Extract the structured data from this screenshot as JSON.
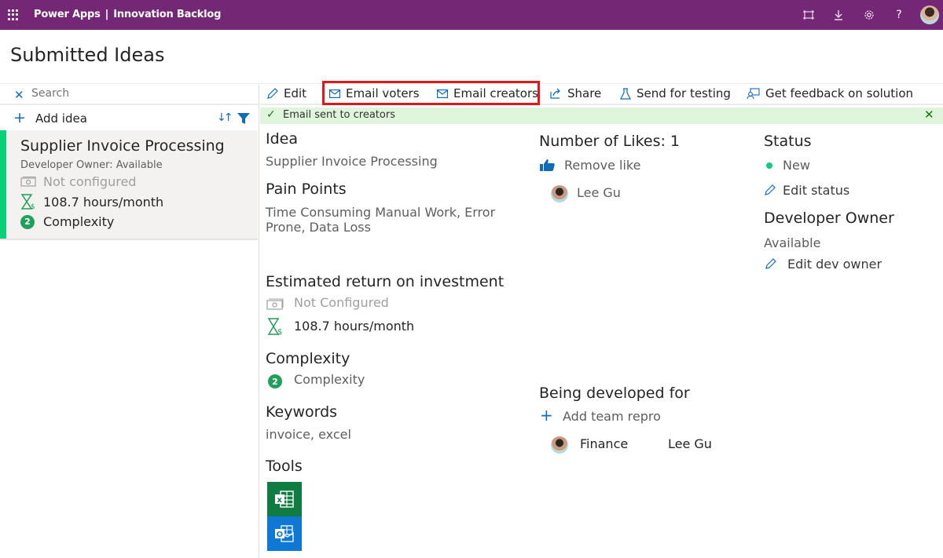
{
  "topbar": {
    "app_name": "Power Apps",
    "separator": "|",
    "app_title": "Innovation Backlog",
    "icons": [
      "fit-screen-icon",
      "download-icon",
      "settings-icon",
      "help-icon",
      "user-avatar"
    ],
    "help_glyph": "?",
    "background": "#742774"
  },
  "page": {
    "title": "Submitted Ideas"
  },
  "left_panel": {
    "search": {
      "placeholder": "Search",
      "value": ""
    },
    "add_idea_label": "Add idea",
    "ideas": [
      {
        "title": "Supplier Invoice Processing",
        "developer_owner": "Developer Owner: Available",
        "roi": "Not configured",
        "hours": "108.7 hours/month",
        "complexity_value": "2",
        "complexity_label": "Complexity",
        "accent_color": "#0bd07a"
      }
    ]
  },
  "toolbar": {
    "edit": "Edit",
    "email_voters": "Email voters",
    "email_creators": "Email creators",
    "share": "Share",
    "send_for_testing": "Send for testing",
    "get_feedback": "Get feedback on solution"
  },
  "banner": {
    "check": "✓",
    "message": "Email sent to creators",
    "close": "✕"
  },
  "detail": {
    "idea_heading": "Idea",
    "idea_value": "Supplier Invoice Processing",
    "pain_points_heading": "Pain Points",
    "pain_points_line1": "Time Consuming Manual Work, Error",
    "pain_points_line2": "Prone, Data Loss",
    "roi_heading": "Estimated return on investment",
    "roi_value": "Not Configured",
    "hours_value": "108.7 hours/month",
    "complexity_heading": "Complexity",
    "complexity_value": "2",
    "complexity_label": "Complexity",
    "keywords_heading": "Keywords",
    "keywords_value": "invoice, excel",
    "tools_heading": "Tools",
    "tools": [
      {
        "name": "Excel",
        "glyph": "X",
        "color": "#107c41"
      },
      {
        "name": "Outlook",
        "glyph": "O",
        "color": "#0f78d4"
      }
    ],
    "likes_heading": "Number of Likes: 1",
    "remove_like": "Remove like",
    "likers": [
      "Lee Gu"
    ],
    "being_developed_heading": "Being developed for",
    "add_team_label": "Add team repro",
    "teams": [
      {
        "team": "Finance",
        "person": "Lee Gu"
      }
    ],
    "status_heading": "Status",
    "status_value": "New",
    "edit_status": "Edit status",
    "dev_owner_heading": "Developer Owner",
    "dev_owner_value": "Available",
    "edit_dev_owner": "Edit dev owner"
  }
}
